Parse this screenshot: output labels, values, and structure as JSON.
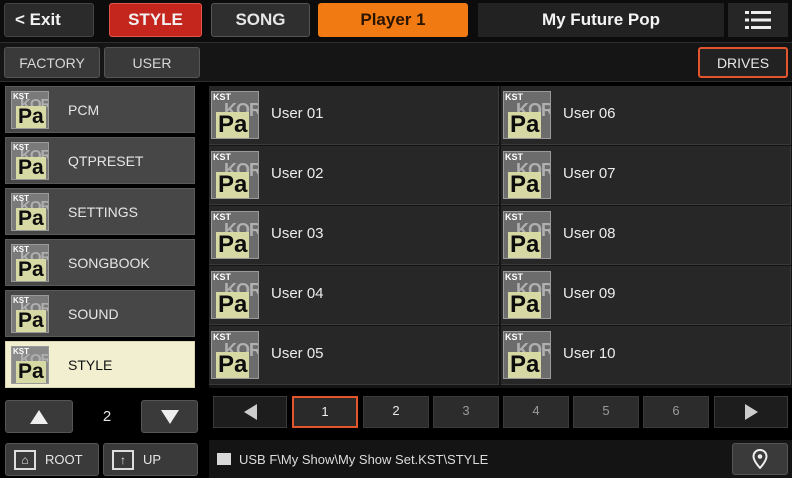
{
  "topbar": {
    "exit_label": "< Exit",
    "style_label": "STYLE",
    "song_label": "SONG",
    "player_label": "Player 1",
    "title": "My Future Pop",
    "menu_icon": "hamburger-menu-icon"
  },
  "subbar": {
    "factory_label": "FACTORY",
    "user_label": "USER",
    "drives_label": "DRIVES"
  },
  "folders": [
    {
      "label": "PCM",
      "badge": "KST",
      "logo": "KORG",
      "icon": "Pa"
    },
    {
      "label": "QTPRESET",
      "badge": "KST",
      "logo": "KORG",
      "icon": "Pa"
    },
    {
      "label": "SETTINGS",
      "badge": "KST",
      "logo": "KORG",
      "icon": "Pa"
    },
    {
      "label": "SONGBOOK",
      "badge": "KST",
      "logo": "KORG",
      "icon": "Pa"
    },
    {
      "label": "SOUND",
      "badge": "KST",
      "logo": "KORG",
      "icon": "Pa"
    },
    {
      "label": "STYLE",
      "badge": "KST",
      "logo": "KORG",
      "icon": "Pa",
      "selected": true
    }
  ],
  "folder_pager": {
    "page": "2"
  },
  "nav": {
    "root_label": "ROOT",
    "up_label": "UP"
  },
  "banks": [
    {
      "label": "User 01",
      "badge": "KST",
      "logo": "KORG",
      "icon": "Pa"
    },
    {
      "label": "User 02",
      "badge": "KST",
      "logo": "KORG",
      "icon": "Pa"
    },
    {
      "label": "User 03",
      "badge": "KST",
      "logo": "KORG",
      "icon": "Pa"
    },
    {
      "label": "User 04",
      "badge": "KST",
      "logo": "KORG",
      "icon": "Pa"
    },
    {
      "label": "User 05",
      "badge": "KST",
      "logo": "KORG",
      "icon": "Pa"
    },
    {
      "label": "User 06",
      "badge": "KST",
      "logo": "KORG",
      "icon": "Pa"
    },
    {
      "label": "User 07",
      "badge": "KST",
      "logo": "KORG",
      "icon": "Pa"
    },
    {
      "label": "User 08",
      "badge": "KST",
      "logo": "KORG",
      "icon": "Pa"
    },
    {
      "label": "User 09",
      "badge": "KST",
      "logo": "KORG",
      "icon": "Pa"
    },
    {
      "label": "User 10",
      "badge": "KST",
      "logo": "KORG",
      "icon": "Pa"
    }
  ],
  "pager": {
    "pages": [
      "1",
      "2",
      "3",
      "4",
      "5",
      "6"
    ],
    "active_page": "1"
  },
  "path": {
    "text": "USB F\\My Show\\My Show Set.KST\\STYLE"
  },
  "colors": {
    "accent_red": "#c4261e",
    "player_orange": "#f17a12",
    "highlight_border": "#e2552d",
    "selected_folder": "#f1efcf"
  }
}
